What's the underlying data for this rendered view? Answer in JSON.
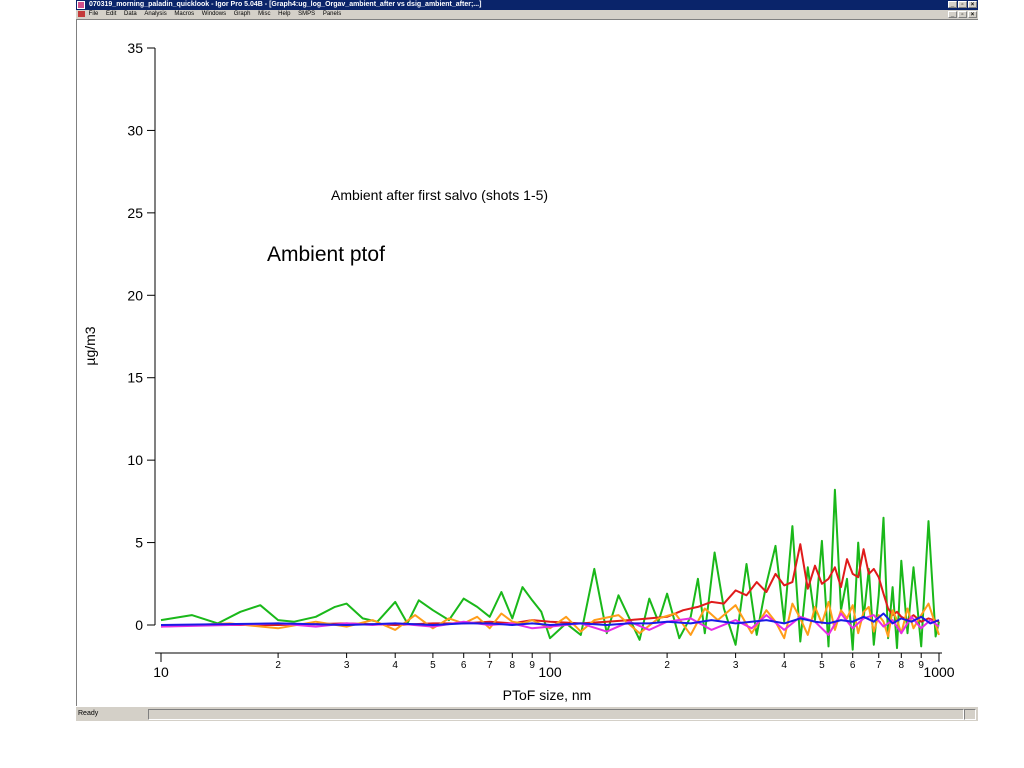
{
  "window": {
    "title": "070319_morning_paladin_quicklook - Igor Pro 5.04B - [Graph4:ug_log_Orgav_ambient_after vs dsig_ambient_after;...]",
    "title_buttons": [
      "_",
      "▫",
      "×"
    ],
    "menu_buttons": [
      "_",
      "▫",
      "×"
    ]
  },
  "menu": [
    "File",
    "Edit",
    "Data",
    "Analysis",
    "Macros",
    "Windows",
    "Graph",
    "Misc",
    "Help",
    "SMPS",
    "Panels"
  ],
  "status": {
    "text": "Ready"
  },
  "chart_data": {
    "type": "line",
    "title": "",
    "annotations": [
      "Ambient after first salvo (shots 1-5)",
      "Ambient ptof"
    ],
    "xlabel": "PToF size, nm",
    "ylabel": "µg/m3",
    "x_scale": "log",
    "xlim": [
      10,
      1000
    ],
    "ylim": [
      -1.5,
      35
    ],
    "y_ticks": [
      0,
      5,
      10,
      15,
      20,
      25,
      30,
      35
    ],
    "x_major_ticks": [
      {
        "value": 10,
        "label": "10"
      },
      {
        "value": 100,
        "label": "100"
      },
      {
        "value": 1000,
        "label": "1000"
      }
    ],
    "x_minor_ticks": [
      {
        "value": 20,
        "label": "2"
      },
      {
        "value": 30,
        "label": "3"
      },
      {
        "value": 40,
        "label": "4"
      },
      {
        "value": 50,
        "label": "5"
      },
      {
        "value": 60,
        "label": "6"
      },
      {
        "value": 70,
        "label": "7"
      },
      {
        "value": 80,
        "label": "8"
      },
      {
        "value": 90,
        "label": "9"
      },
      {
        "value": 200,
        "label": "2"
      },
      {
        "value": 300,
        "label": "3"
      },
      {
        "value": 400,
        "label": "4"
      },
      {
        "value": 500,
        "label": "5"
      },
      {
        "value": 600,
        "label": "6"
      },
      {
        "value": 700,
        "label": "7"
      },
      {
        "value": 800,
        "label": "8"
      },
      {
        "value": 900,
        "label": "9"
      }
    ],
    "grid": false,
    "legend": "none",
    "series": [
      {
        "color": "#1ab81a",
        "x": [
          10,
          12,
          14,
          16,
          18,
          20,
          22,
          25,
          28,
          30,
          33,
          36,
          40,
          43,
          46,
          50,
          55,
          60,
          65,
          70,
          75,
          80,
          85,
          90,
          95,
          100,
          110,
          120,
          130,
          140,
          150,
          160,
          170,
          180,
          190,
          200,
          215,
          230,
          240,
          250,
          265,
          280,
          300,
          320,
          340,
          360,
          380,
          400,
          420,
          440,
          460,
          480,
          500,
          520,
          540,
          560,
          580,
          600,
          620,
          640,
          660,
          680,
          700,
          720,
          740,
          760,
          780,
          800,
          830,
          860,
          900,
          940,
          980,
          1000
        ],
        "y": [
          0.3,
          0.6,
          0.1,
          0.8,
          1.2,
          0.3,
          0.2,
          0.5,
          1.1,
          1.3,
          0.4,
          0.2,
          1.4,
          0.1,
          1.5,
          0.9,
          0.3,
          1.6,
          1.1,
          0.5,
          2.0,
          0.4,
          2.3,
          1.5,
          0.8,
          -0.8,
          0.1,
          -0.6,
          3.4,
          -0.5,
          1.8,
          0.4,
          -0.9,
          1.6,
          0.2,
          1.9,
          -0.8,
          0.5,
          2.8,
          -0.5,
          4.4,
          1.0,
          -1.2,
          3.7,
          -0.6,
          2.5,
          4.8,
          0.2,
          6.0,
          -1.0,
          3.5,
          0.3,
          5.1,
          -1.3,
          8.2,
          0.9,
          2.8,
          -1.5,
          5.0,
          0.4,
          3.4,
          -1.2,
          1.8,
          6.5,
          -0.8,
          2.3,
          -1.4,
          3.9,
          -0.5,
          3.5,
          -1.3,
          6.3,
          -0.7,
          0.2
        ]
      },
      {
        "color": "#e01b1b",
        "x": [
          10,
          20,
          30,
          40,
          50,
          60,
          70,
          80,
          90,
          100,
          120,
          140,
          160,
          180,
          200,
          220,
          240,
          260,
          280,
          300,
          320,
          340,
          360,
          380,
          400,
          420,
          440,
          460,
          480,
          500,
          520,
          540,
          560,
          580,
          600,
          620,
          640,
          660,
          680,
          700,
          720,
          740,
          760,
          780,
          800,
          830,
          860,
          900,
          940,
          1000
        ],
        "y": [
          0,
          0,
          0.1,
          0,
          0.1,
          0.1,
          0.2,
          0.1,
          0.3,
          0.2,
          0.1,
          0.2,
          0.3,
          0.4,
          0.5,
          0.9,
          1.1,
          1.4,
          1.3,
          2.1,
          1.8,
          2.6,
          2.0,
          3.1,
          2.4,
          2.6,
          4.9,
          2.2,
          3.6,
          2.5,
          2.8,
          3.5,
          2.3,
          4.0,
          3.1,
          2.9,
          4.6,
          3.1,
          3.4,
          2.9,
          1.9,
          1.0,
          0.6,
          0.8,
          0.5,
          0.3,
          0.6,
          0.2,
          0.4,
          0.2
        ]
      },
      {
        "color": "#ff9d1a",
        "x": [
          10,
          15,
          20,
          25,
          30,
          35,
          40,
          45,
          50,
          55,
          60,
          65,
          70,
          75,
          80,
          85,
          90,
          100,
          110,
          120,
          130,
          150,
          170,
          190,
          210,
          230,
          250,
          270,
          300,
          330,
          360,
          380,
          400,
          420,
          440,
          460,
          480,
          500,
          520,
          540,
          560,
          580,
          600,
          620,
          640,
          660,
          680,
          700,
          720,
          740,
          760,
          780,
          800,
          830,
          860,
          900,
          940,
          1000
        ],
        "y": [
          -0.1,
          0.1,
          -0.2,
          0.2,
          -0.1,
          0.3,
          -0.3,
          0.6,
          -0.2,
          0.4,
          0.1,
          0.5,
          -0.2,
          0.7,
          0.2,
          0.1,
          0.3,
          -0.2,
          0.5,
          -0.4,
          0.3,
          0.6,
          -0.5,
          0.4,
          0.7,
          -0.6,
          1.0,
          0.3,
          1.2,
          -0.5,
          0.9,
          0.2,
          -0.8,
          1.3,
          0.4,
          -0.6,
          1.1,
          0.1,
          1.4,
          -0.3,
          0.9,
          0.4,
          1.2,
          -0.5,
          0.8,
          1.1,
          -0.4,
          0.6,
          0.2,
          -0.7,
          0.9,
          0.3,
          -0.5,
          1.0,
          -0.2,
          0.6,
          1.3,
          -0.6
        ]
      },
      {
        "color": "#e62de6",
        "x": [
          10,
          15,
          20,
          25,
          30,
          35,
          40,
          50,
          60,
          70,
          80,
          90,
          100,
          120,
          140,
          160,
          180,
          200,
          230,
          260,
          300,
          330,
          360,
          400,
          440,
          480,
          520,
          560,
          600,
          640,
          680,
          720,
          760,
          800,
          850,
          900,
          950,
          1000
        ],
        "y": [
          -0.1,
          0,
          0.1,
          -0.1,
          0.1,
          0,
          0.1,
          -0.1,
          0.2,
          0,
          0.1,
          -0.2,
          -0.1,
          0.1,
          -0.4,
          0.2,
          -0.3,
          0.2,
          0.4,
          -0.3,
          0.3,
          -0.2,
          0.6,
          -0.3,
          0.5,
          0.2,
          -0.6,
          0.7,
          -0.2,
          0.4,
          0.6,
          -0.1,
          0.3,
          -0.5,
          0.5,
          -0.2,
          0.3,
          -0.1
        ]
      },
      {
        "color": "#1a1ae6",
        "x": [
          10,
          20,
          30,
          40,
          50,
          60,
          70,
          80,
          90,
          100,
          120,
          140,
          160,
          180,
          200,
          230,
          260,
          300,
          330,
          360,
          400,
          440,
          480,
          520,
          560,
          600,
          640,
          680,
          720,
          760,
          800,
          850,
          900,
          950,
          1000
        ],
        "y": [
          0,
          0.1,
          0,
          0.1,
          0,
          0.1,
          0.1,
          0,
          0.1,
          0,
          0.1,
          0,
          0.1,
          0.1,
          0.2,
          0.1,
          0.3,
          0.1,
          0.2,
          0.3,
          0.1,
          0.4,
          0.2,
          0.1,
          0.3,
          0.2,
          0.5,
          0.2,
          0.7,
          0.1,
          0.4,
          0.2,
          0.5,
          0.1,
          0.3
        ]
      }
    ]
  }
}
